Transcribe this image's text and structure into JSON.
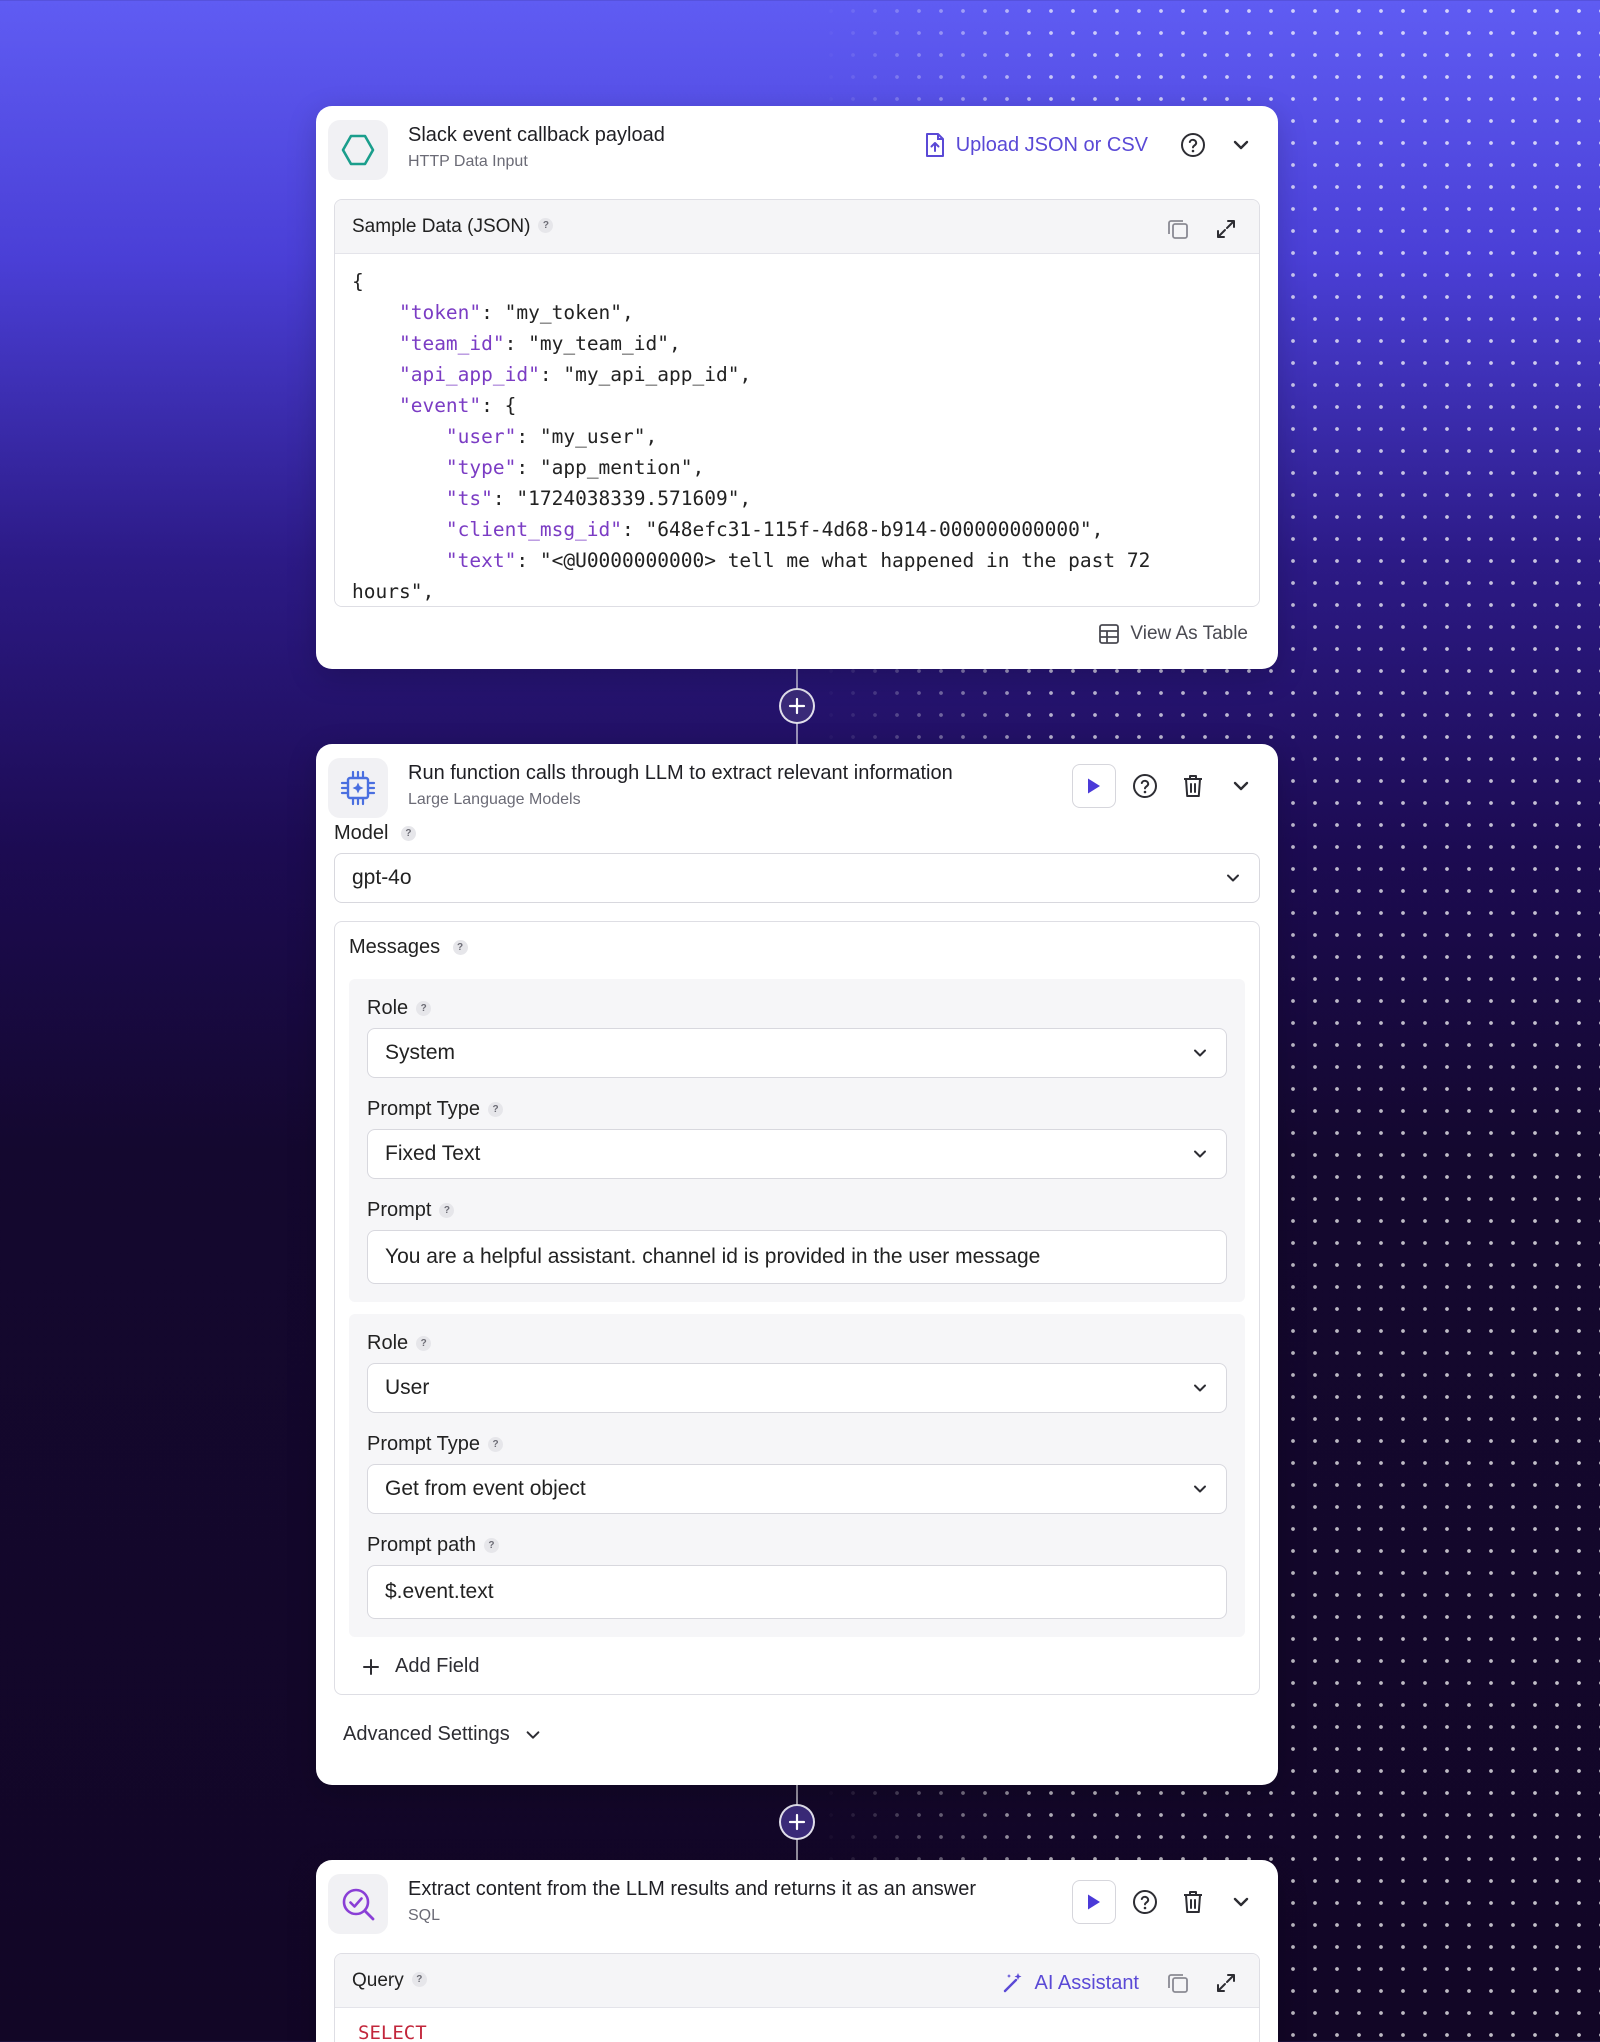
{
  "colors": {
    "accent": "#5a49d6",
    "teal": "#1a9e8c",
    "keyword_purple": "#7b3cc4",
    "sql_keyword": "#c2263b"
  },
  "card1": {
    "title": "Slack event callback payload",
    "subtitle": "HTTP Data Input",
    "icon": "hexagon-icon",
    "upload_label": "Upload JSON or CSV",
    "panel_label": "Sample Data (JSON)",
    "view_table_label": "View As Table",
    "json_lines": [
      {
        "indent": "",
        "key": "",
        "rest": "{"
      },
      {
        "indent": "    ",
        "key": "\"token\"",
        "rest": ": \"my_token\","
      },
      {
        "indent": "    ",
        "key": "\"team_id\"",
        "rest": ": \"my_team_id\","
      },
      {
        "indent": "    ",
        "key": "\"api_app_id\"",
        "rest": ": \"my_api_app_id\","
      },
      {
        "indent": "    ",
        "key": "\"event\"",
        "rest": ": {"
      },
      {
        "indent": "        ",
        "key": "\"user\"",
        "rest": ": \"my_user\","
      },
      {
        "indent": "        ",
        "key": "\"type\"",
        "rest": ": \"app_mention\","
      },
      {
        "indent": "        ",
        "key": "\"ts\"",
        "rest": ": \"1724038339.571609\","
      },
      {
        "indent": "        ",
        "key": "\"client_msg_id\"",
        "rest": ": \"648efc31-115f-4d68-b914-000000000000\","
      },
      {
        "indent": "        ",
        "key": "\"text\"",
        "rest": ": \"<@U0000000000> tell me what happened in the past 72"
      },
      {
        "indent": "",
        "key": "",
        "rest": "hours\","
      }
    ]
  },
  "card2": {
    "title": "Run function calls through LLM to extract relevant information",
    "subtitle": "Large Language Models",
    "icon": "cpu-chip-icon",
    "model_label": "Model",
    "model_value": "gpt-4o",
    "messages_label": "Messages",
    "group1": {
      "role_label": "Role",
      "role_value": "System",
      "prompt_type_label": "Prompt Type",
      "prompt_type_value": "Fixed Text",
      "prompt_label": "Prompt",
      "prompt_value": "You are a helpful assistant. channel id is provided in the user message"
    },
    "group2": {
      "role_label": "Role",
      "role_value": "User",
      "prompt_type_label": "Prompt Type",
      "prompt_type_value": "Get from event object",
      "prompt_path_label": "Prompt path",
      "prompt_path_value": "$.event.text"
    },
    "add_field_label": "Add Field",
    "advanced_label": "Advanced Settings"
  },
  "card3": {
    "title": "Extract content from the LLM results and returns it as an answer",
    "subtitle": "SQL",
    "icon": "search-check-icon",
    "query_label": "Query",
    "ai_assistant_label": "AI Assistant",
    "sql_first_line": "SELECT"
  }
}
